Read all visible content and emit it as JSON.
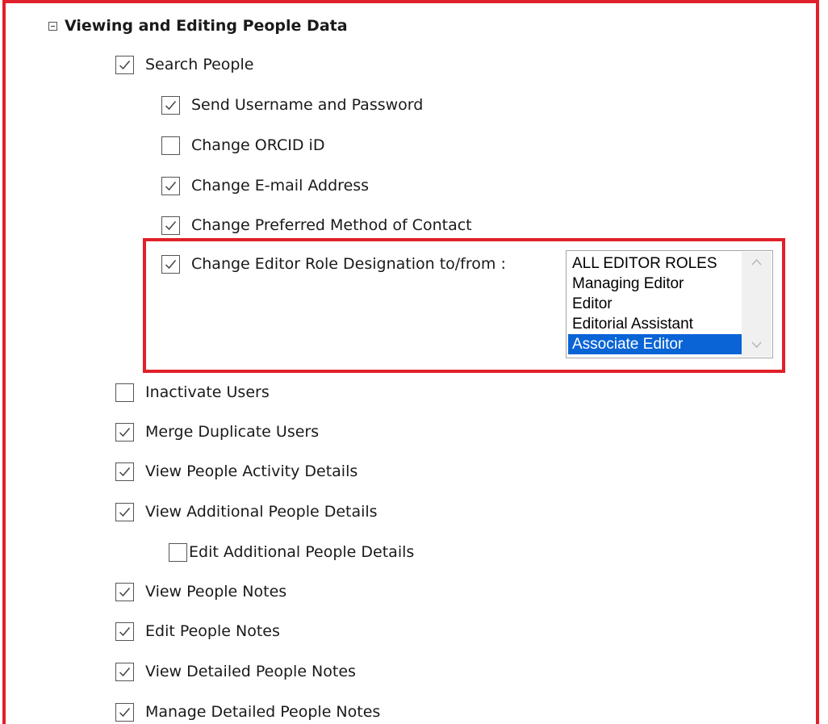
{
  "section": {
    "title": "Viewing and Editing People Data",
    "collapse_icon": "collapse-minus-icon"
  },
  "permissions": [
    {
      "label": "Search People",
      "checked": true
    },
    {
      "label": "Send Username and Password",
      "checked": true
    },
    {
      "label": "Change ORCID iD",
      "checked": false
    },
    {
      "label": "Change E-mail Address",
      "checked": true
    },
    {
      "label": "Change Preferred Method of Contact",
      "checked": true
    },
    {
      "label": "Change Editor Role Designation to/from :",
      "checked": true
    },
    {
      "label": "Inactivate Users",
      "checked": false
    },
    {
      "label": "Merge Duplicate Users",
      "checked": true
    },
    {
      "label": "View People Activity Details",
      "checked": true
    },
    {
      "label": "View Additional People Details",
      "checked": true
    },
    {
      "label": "Edit Additional People Details",
      "checked": false
    },
    {
      "label": "View People Notes",
      "checked": true
    },
    {
      "label": "Edit People Notes",
      "checked": true
    },
    {
      "label": "View Detailed People Notes",
      "checked": true
    },
    {
      "label": "Manage Detailed People Notes",
      "checked": true
    }
  ],
  "editor_roles": {
    "options": [
      "ALL EDITOR ROLES",
      "Managing Editor",
      "Editor",
      "Editorial Assistant",
      "Associate Editor"
    ],
    "selected": "Associate Editor"
  },
  "colors": {
    "highlight_border": "#e0202a",
    "selected_option_bg": "#0a64d6"
  }
}
